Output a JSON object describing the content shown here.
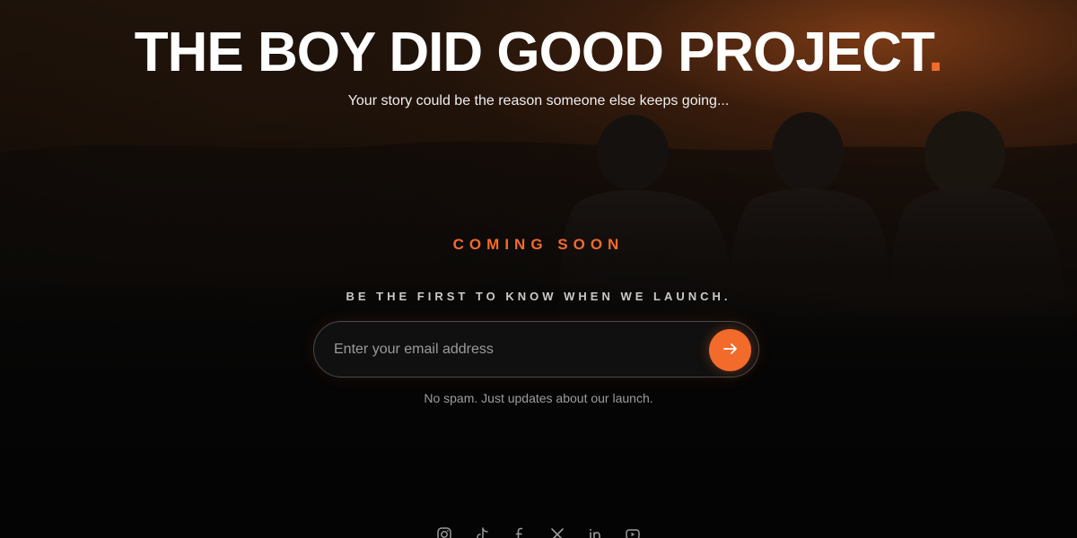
{
  "hero": {
    "title": "THE BOY DID GOOD PROJECT",
    "title_dot": ".",
    "subtitle": "Your story could be the reason someone else keeps going..."
  },
  "status": {
    "coming_soon": "COMING SOON",
    "tagline": "BE THE FIRST TO KNOW WHEN WE LAUNCH."
  },
  "signup": {
    "email_placeholder": "Enter your email address",
    "submit_icon": "arrow-right-icon",
    "note": "No spam. Just updates about our launch."
  },
  "socials": [
    {
      "name": "instagram-icon"
    },
    {
      "name": "tiktok-icon"
    },
    {
      "name": "facebook-icon"
    },
    {
      "name": "x-icon"
    },
    {
      "name": "linkedin-icon"
    },
    {
      "name": "youtube-icon"
    }
  ],
  "colors": {
    "accent": "#f26b2b",
    "background": "#050505",
    "text": "#ffffff"
  }
}
